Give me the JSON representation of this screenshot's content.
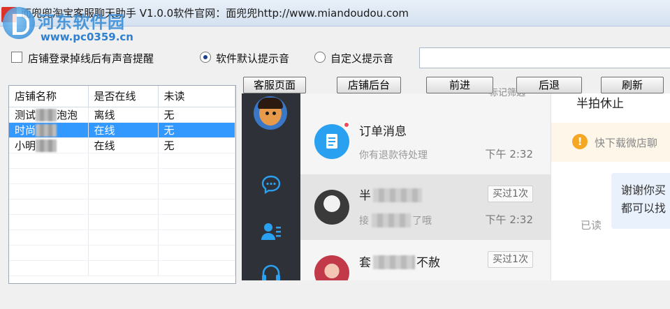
{
  "window": {
    "title": "面兜兜淘宝客服聊天助手 V1.0.0软件官网：面兜兜http://www.miandoudou.com"
  },
  "watermark": {
    "site_name": "河东软件园",
    "site_url": "www.pc0359.cn"
  },
  "options": {
    "offline_sound_label": "店铺登录掉线后有声音提醒",
    "offline_sound_checked": false,
    "default_tone_label": "软件默认提示音",
    "custom_tone_label": "自定义提示音",
    "selected_tone": "default",
    "custom_tone_path": ""
  },
  "shop_table": {
    "columns": [
      "店铺名称",
      "是否在线",
      "未读"
    ],
    "rows": [
      {
        "name_start": "测试",
        "name_end": "泡泡",
        "status": "离线",
        "unread": "无",
        "selected": false
      },
      {
        "name_start": "时尚",
        "name_end": "",
        "status": "在线",
        "unread": "无",
        "selected": true
      },
      {
        "name_start": "小明",
        "name_end": "",
        "status": "在线",
        "unread": "无",
        "selected": false
      }
    ]
  },
  "toolbar": {
    "service_page": "客服页面",
    "shop_backend": "店铺后台",
    "forward": "前进",
    "back": "后退",
    "refresh": "刷新"
  },
  "browser": {
    "filter_label": "标记筛选",
    "nav_icons": [
      "chat-bubble-icon",
      "contacts-icon",
      "headset-icon"
    ],
    "conversations": [
      {
        "name": "订单消息",
        "preview": "你有退款待处理",
        "time": "下午 2:32",
        "tag": "",
        "unread_dot": true,
        "avatar": "order-message-icon"
      },
      {
        "name_start": "半",
        "name_end": "",
        "preview_start": "接",
        "preview_end": "了哦",
        "time": "下午 2:32",
        "tag": "买过1次",
        "unread_dot": false,
        "avatar": "customer-avatar"
      },
      {
        "name_start": "套",
        "name_end": "不赦",
        "preview": "",
        "time": "",
        "tag": "买过1次",
        "unread_dot": false,
        "avatar": "customer-avatar"
      }
    ],
    "chat": {
      "header": "半拍休止",
      "warning": "快下载微店聊",
      "bubble_line1": "谢谢你买",
      "bubble_line2": "都可以找",
      "read_mark": "已读"
    }
  },
  "colors": {
    "selection": "#3399ff",
    "nav_bg": "#2e3238",
    "accent_blue": "#2aa0f0",
    "warning_orange": "#f5a623",
    "unread_red": "#f24957"
  }
}
